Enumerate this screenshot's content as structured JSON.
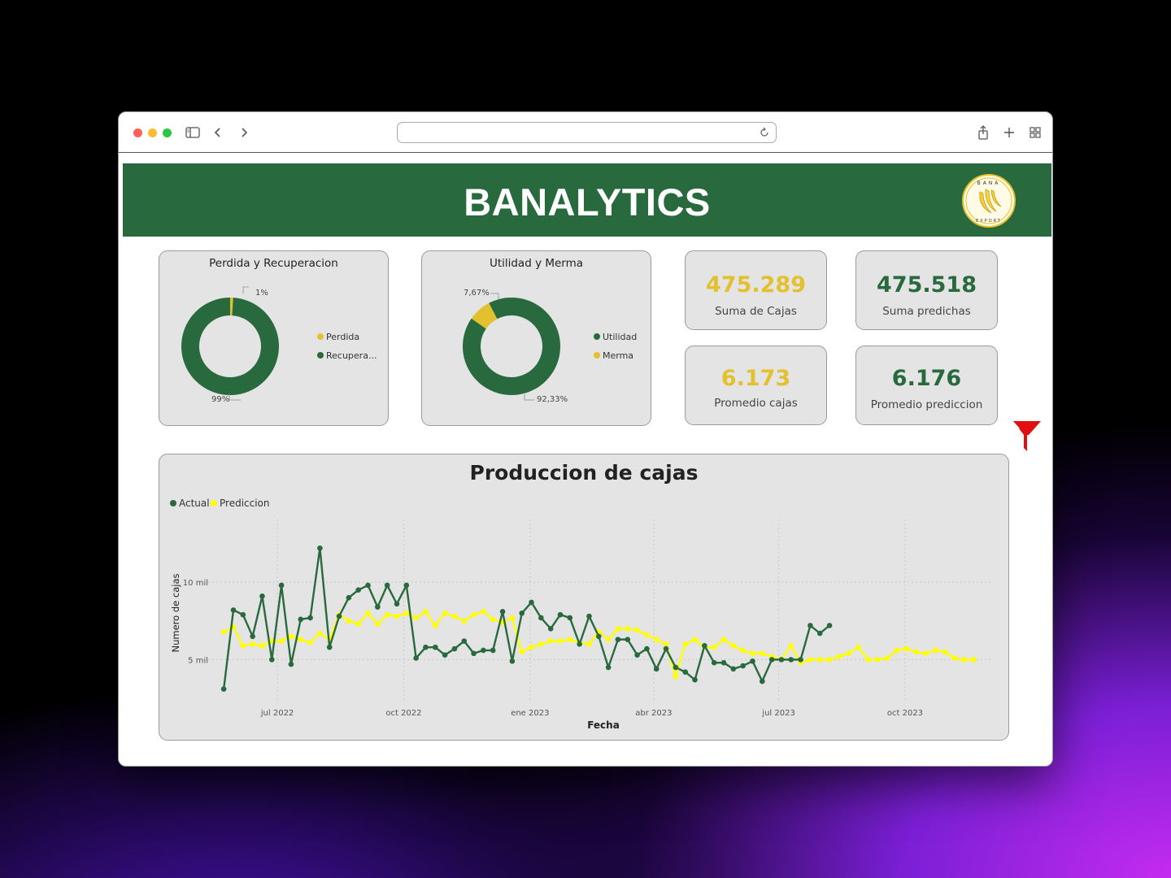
{
  "browser": {
    "url": "",
    "icons": [
      "sidebar-icon",
      "back-icon",
      "forward-icon",
      "reload-icon",
      "share-icon",
      "new-tab-icon",
      "tab-overview-icon"
    ]
  },
  "header": {
    "title": "BANALYTICS",
    "logo_text": "BANA EXPORT",
    "color": "#286a3e"
  },
  "donut1": {
    "title": "Perdida y Recuperacion",
    "legend": [
      {
        "label": "Perdida",
        "color": "#e3c12e"
      },
      {
        "label": "Recupera...",
        "color": "#286a3e"
      }
    ],
    "label_small": "1%",
    "label_large": "99%"
  },
  "donut2": {
    "title": "Utilidad y Merma",
    "legend": [
      {
        "label": "Utilidad",
        "color": "#286a3e"
      },
      {
        "label": "Merma",
        "color": "#e3c12e"
      }
    ],
    "label_small": "7,67%",
    "label_large": "92,33%"
  },
  "kpis": [
    {
      "value": "475.289",
      "label": "Suma de Cajas",
      "color": "#e3c12e"
    },
    {
      "value": "475.518",
      "label": "Suma predichas",
      "color": "#286a3e"
    },
    {
      "value": "6.173",
      "label": "Promedio cajas",
      "color": "#e3c12e"
    },
    {
      "value": "6.176",
      "label": "Promedio prediccion",
      "color": "#286a3e"
    }
  ],
  "chart_data": [
    {
      "type": "pie",
      "title": "Perdida y Recuperacion",
      "categories": [
        "Perdida",
        "Recupera..."
      ],
      "values": [
        1,
        99
      ],
      "colors": [
        "#e3c12e",
        "#286a3e"
      ],
      "donut": true,
      "legend": "right"
    },
    {
      "type": "pie",
      "title": "Utilidad y Merma",
      "categories": [
        "Utilidad",
        "Merma"
      ],
      "values": [
        92.33,
        7.67
      ],
      "colors": [
        "#286a3e",
        "#e3c12e"
      ],
      "donut": true,
      "legend": "right"
    },
    {
      "type": "line",
      "title": "Produccion de cajas",
      "xlabel": "Fecha",
      "ylabel": "Numero de cajas",
      "x_ticks": [
        "jul 2022",
        "oct 2022",
        "ene 2023",
        "abr 2023",
        "jul 2023",
        "oct 2023"
      ],
      "y_ticks": [
        {
          "value": 5000,
          "label": "5 mil"
        },
        {
          "value": 10000,
          "label": "10 mil"
        }
      ],
      "ylim": [
        2500,
        13000
      ],
      "legend": "top-left",
      "grid": true,
      "series": [
        {
          "name": "Actual",
          "color": "#286a3e",
          "values": [
            3100,
            8200,
            7900,
            6500,
            9100,
            5000,
            9800,
            4700,
            7600,
            7700,
            12200,
            5800,
            7800,
            9000,
            9500,
            9800,
            8400,
            9800,
            8600,
            9800,
            5100,
            5800,
            5800,
            5300,
            5700,
            6200,
            5400,
            5600,
            5600,
            8100,
            4900,
            8000,
            8700,
            7700,
            7000,
            7900,
            7700,
            6000,
            7800,
            6500,
            4500,
            6300,
            6300,
            5300,
            5700,
            4400,
            5700,
            4500,
            4200,
            3700,
            5900,
            4800,
            4800,
            4400,
            4600,
            4900,
            3600,
            5000,
            5000,
            5000,
            5000,
            7200,
            6700,
            7200
          ],
          "x_range": [
            "2022-05-23",
            "2023-08-14"
          ]
        },
        {
          "name": "Prediccion",
          "color": "#ffff00",
          "values": [
            6800,
            7100,
            5900,
            6000,
            5900,
            6200,
            6200,
            6500,
            6300,
            6100,
            6700,
            6300,
            7900,
            7500,
            7300,
            8000,
            7300,
            7900,
            7800,
            8000,
            7700,
            8100,
            7200,
            8000,
            7800,
            7500,
            7900,
            8100,
            7600,
            7400,
            7700,
            5500,
            5800,
            6000,
            6200,
            6200,
            6300,
            6100,
            6000,
            6800,
            6300,
            7000,
            7000,
            6900,
            6600,
            6300,
            6000,
            3900,
            6000,
            6300,
            5800,
            5800,
            6300,
            5900,
            5600,
            5400,
            5400,
            5200,
            5000,
            5900,
            4800,
            5000,
            5000,
            5000,
            5200,
            5400,
            5800,
            5000,
            5000,
            5100,
            5600,
            5700,
            5500,
            5400,
            5600,
            5500,
            5100,
            5000,
            5000
          ],
          "x_range": [
            "2022-05-23",
            "2023-11-13"
          ]
        }
      ]
    }
  ]
}
